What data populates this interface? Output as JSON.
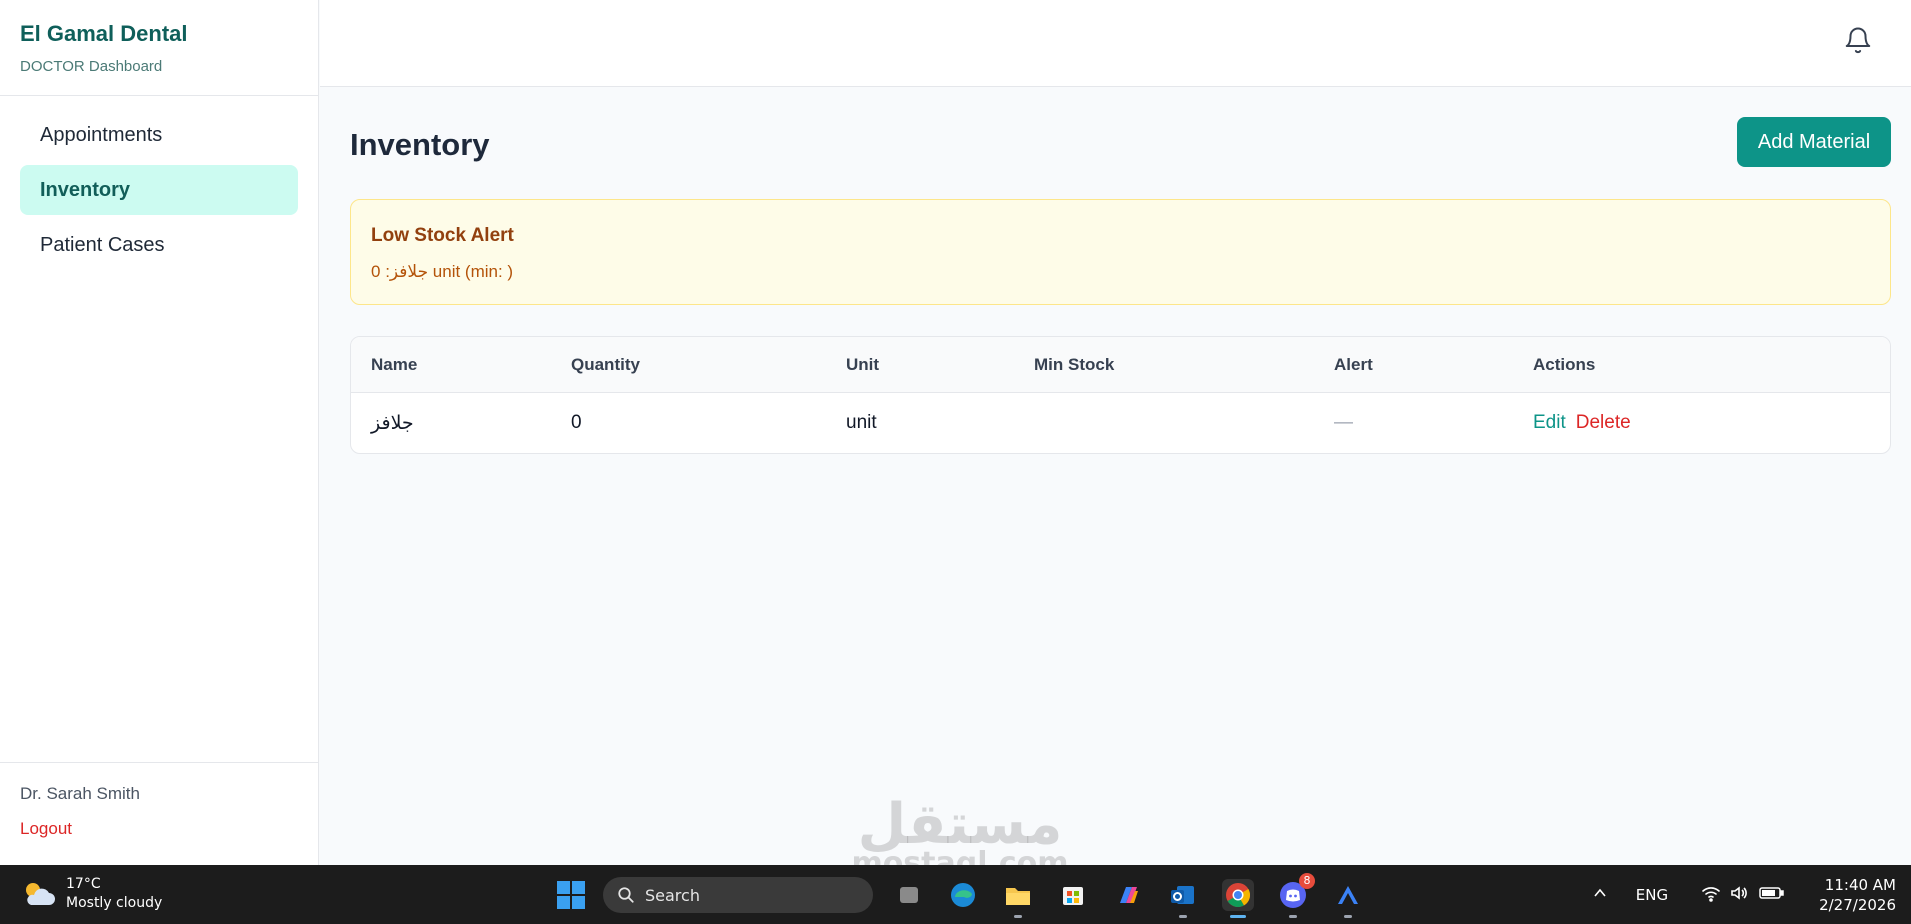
{
  "app": {
    "brand": "El Gamal Dental",
    "subtitle": "DOCTOR Dashboard"
  },
  "sidebar": {
    "items": [
      {
        "label": "Appointments",
        "active": false
      },
      {
        "label": "Inventory",
        "active": true
      },
      {
        "label": "Patient Cases",
        "active": false
      }
    ],
    "user_name": "Dr. Sarah Smith",
    "logout_label": "Logout"
  },
  "topbar": {
    "icon": "bell-icon"
  },
  "page": {
    "title": "Inventory",
    "add_button_label": "Add Material"
  },
  "alert": {
    "title": "Low Stock Alert",
    "item": "جلافز: 0 unit (min: )"
  },
  "table": {
    "headers": [
      "Name",
      "Quantity",
      "Unit",
      "Min Stock",
      "Alert",
      "Actions"
    ],
    "rows": [
      {
        "name": "جلافز",
        "quantity": "0",
        "unit": "unit",
        "min_stock": "",
        "alert": "—",
        "edit_label": "Edit",
        "delete_label": "Delete"
      }
    ]
  },
  "watermark": {
    "arabic": "مستقل",
    "latin": "mostaql.com"
  },
  "taskbar": {
    "weather_temp": "17°C",
    "weather_desc": "Mostly cloudy",
    "search_label": "Search",
    "discord_badge": "8",
    "language": "ENG",
    "time": "11:40 AM",
    "date": "2/27/2026"
  },
  "colors": {
    "accent": "#0d9488",
    "active_nav_bg": "#ccfbf1",
    "danger": "#dc2626",
    "alert_bg": "#fefce8",
    "alert_border": "#fde68a"
  }
}
